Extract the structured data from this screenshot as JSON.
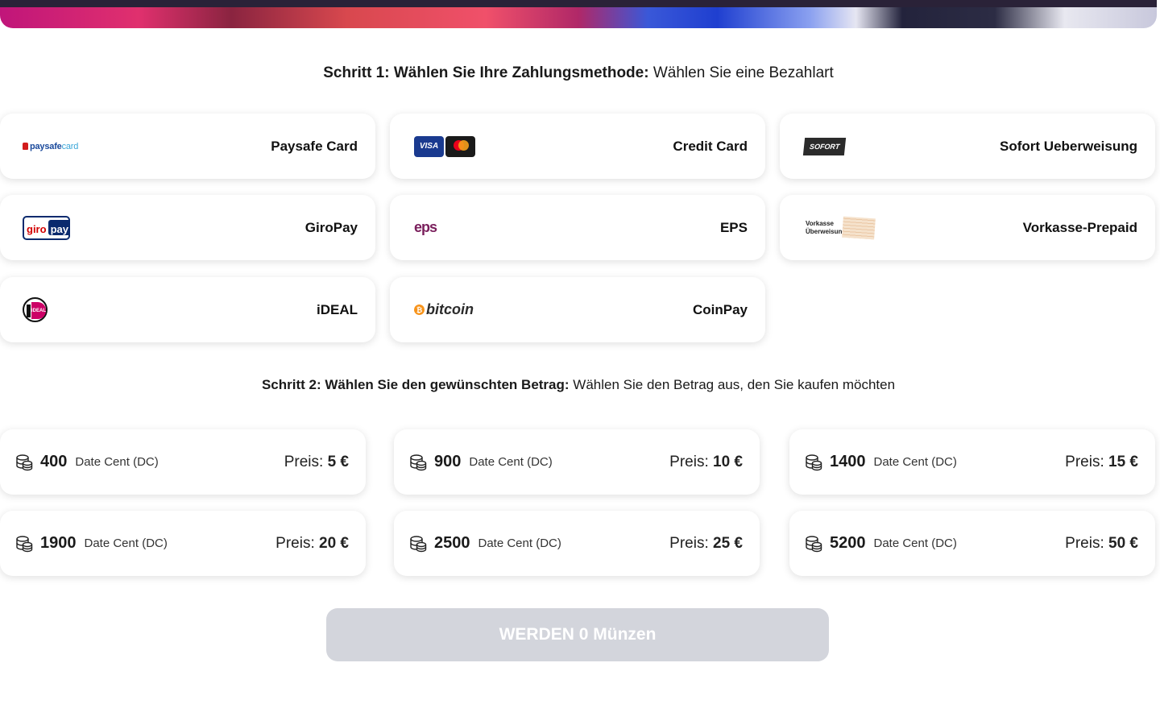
{
  "step1": {
    "title_bold": "Schritt 1: Wählen Sie Ihre Zahlungsmethode:",
    "title_rest": " Wählen Sie eine Bezahlart"
  },
  "payment_methods": [
    {
      "label": "Paysafe Card",
      "logo": "paysafecard-logo",
      "logo_text": "paysafe",
      "logo_text2": "card"
    },
    {
      "label": "Credit Card",
      "logo": "visa-mastercard-logo",
      "logo_text": "VISA"
    },
    {
      "label": "Sofort Ueberweisung",
      "logo": "sofort-logo",
      "logo_text": "SOFORT"
    },
    {
      "label": "GiroPay",
      "logo": "giropay-logo",
      "logo_text": "giro",
      "logo_text2": "pay"
    },
    {
      "label": "EPS",
      "logo": "eps-logo",
      "logo_text": "eps"
    },
    {
      "label": "Vorkasse-Prepaid",
      "logo": "vorkasse-logo",
      "logo_text": "Vorkasse",
      "logo_text2": "Überweisung"
    },
    {
      "label": "iDEAL",
      "logo": "ideal-logo",
      "logo_text": "iDEAL"
    },
    {
      "label": "CoinPay",
      "logo": "bitcoin-logo",
      "logo_text": "bitcoin"
    }
  ],
  "step2": {
    "title_bold": "Schritt 2: Wählen Sie den gewünschten Betrag:",
    "title_rest": " Wählen Sie den Betrag aus, den Sie kaufen möchten"
  },
  "amounts": [
    {
      "coins": "400",
      "unit": "Date Cent (DC)",
      "price_label": "Preis:",
      "price": "5 €"
    },
    {
      "coins": "900",
      "unit": "Date Cent (DC)",
      "price_label": "Preis:",
      "price": "10 €"
    },
    {
      "coins": "1400",
      "unit": "Date Cent (DC)",
      "price_label": "Preis:",
      "price": "15 €"
    },
    {
      "coins": "1900",
      "unit": "Date Cent (DC)",
      "price_label": "Preis:",
      "price": "20 €"
    },
    {
      "coins": "2500",
      "unit": "Date Cent (DC)",
      "price_label": "Preis:",
      "price": "25 €"
    },
    {
      "coins": "5200",
      "unit": "Date Cent (DC)",
      "price_label": "Preis:",
      "price": "50 €"
    }
  ],
  "buy_button": {
    "label": "WERDEN 0 Münzen",
    "enabled": false
  },
  "colors": {
    "button_disabled": "#d3d5dc",
    "card_bg": "#ffffff",
    "text": "#1a1a1a"
  }
}
